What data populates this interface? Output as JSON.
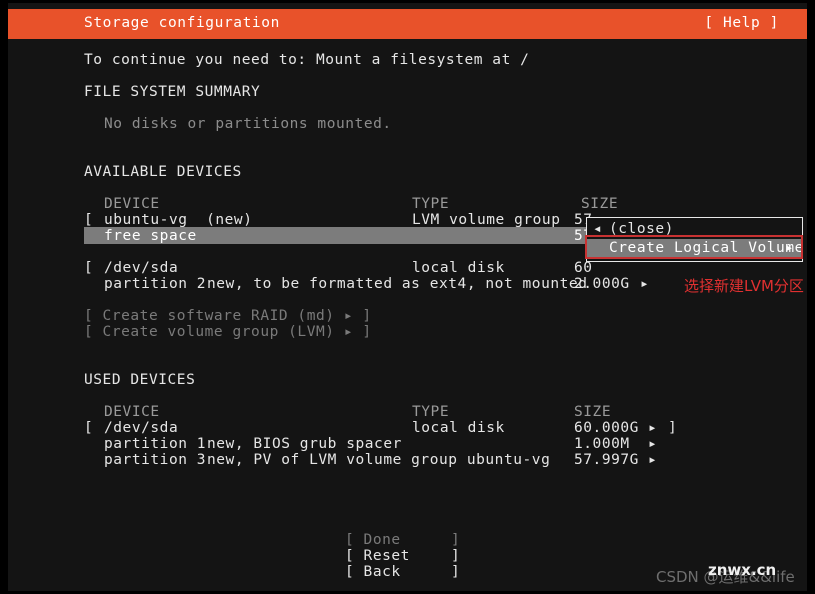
{
  "header": {
    "title": "Storage configuration",
    "help": "[ Help ]"
  },
  "notice": "To continue you need to: Mount a filesystem at /",
  "filesystem_summary": {
    "heading": "FILE SYSTEM SUMMARY",
    "message": "No disks or partitions mounted."
  },
  "available_devices": {
    "heading": "AVAILABLE DEVICES",
    "columns": {
      "device": "DEVICE",
      "type": "TYPE",
      "size": "SIZE"
    },
    "rows": [
      {
        "bracket_open": "[",
        "device": "ubuntu-vg  (new)",
        "type": "LVM volume group",
        "size": "57"
      },
      {
        "bracket_open": "",
        "device": "free space",
        "type": "",
        "size": "57",
        "selected": true
      },
      {
        "bracket_open": "[",
        "device": "/dev/sda",
        "type": "local disk",
        "size": "60"
      },
      {
        "bracket_open": "",
        "device": "partition 2",
        "type": "new, to be formatted as ext4, not mounted",
        "size": "2.000G",
        "arrow": "▸"
      }
    ],
    "actions": [
      "[ Create software RAID (md) ▸ ]",
      "[ Create volume group (LVM) ▸ ]"
    ]
  },
  "used_devices": {
    "heading": "USED DEVICES",
    "columns": {
      "device": "DEVICE",
      "type": "TYPE",
      "size": "SIZE"
    },
    "rows": [
      {
        "bracket_open": "[",
        "device": "/dev/sda",
        "type": "local disk",
        "size": "60.000G",
        "arrow": "▸",
        "bracket_close": "]"
      },
      {
        "bracket_open": "",
        "device": "partition 1",
        "type": "new, BIOS grub spacer",
        "size": "1.000M",
        "arrow": "▸",
        "bracket_close": ""
      },
      {
        "bracket_open": "",
        "device": "partition 3",
        "type": "new, PV of LVM volume group ubuntu-vg",
        "size": "57.997G",
        "arrow": "▸",
        "bracket_close": ""
      }
    ]
  },
  "popup_menu": {
    "left_arrow": "◂",
    "right_arrow": "▸",
    "items": [
      {
        "label": "(close)",
        "selected": false
      },
      {
        "label": "Create Logical Volume",
        "selected": true
      }
    ]
  },
  "annotation": {
    "text": "选择新建LVM分区",
    "color": "#e03030"
  },
  "footer_buttons": [
    {
      "label": "[ Done",
      "close": "]",
      "enabled": false
    },
    {
      "label": "[ Reset",
      "close": "]",
      "enabled": true
    },
    {
      "label": "[ Back",
      "close": "]",
      "enabled": true
    }
  ],
  "watermarks": {
    "csdn": "CSDN @运维&&life",
    "site": "znwx.cn"
  },
  "colors": {
    "accent": "#e8522a",
    "background": "#141414",
    "selection": "#7c7c7c",
    "annotation": "#c83232"
  }
}
